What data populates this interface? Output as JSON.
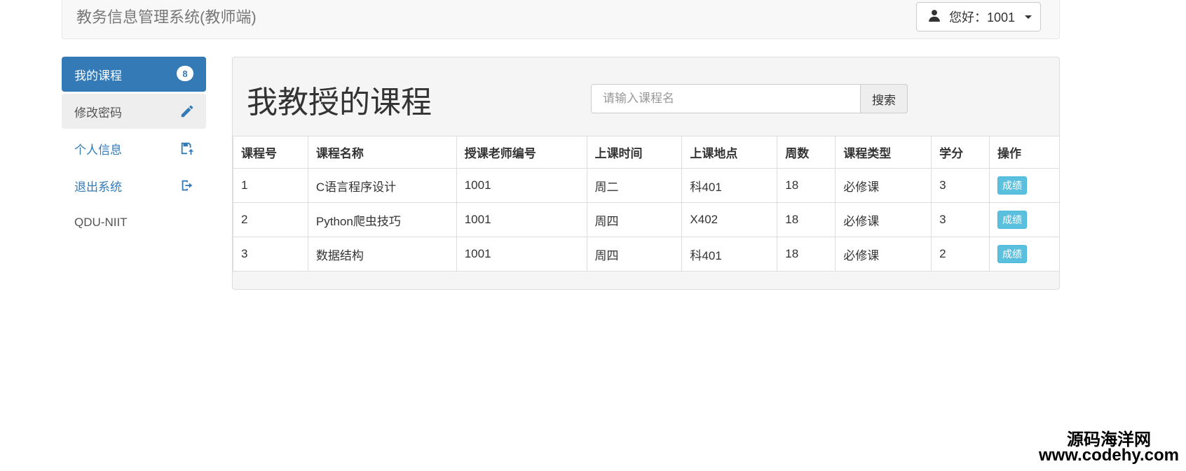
{
  "navbar": {
    "brand": "教务信息管理系统(教师端)",
    "user_label": "您好：1001"
  },
  "sidebar": {
    "items": [
      {
        "label": "我的课程",
        "badge": "8"
      },
      {
        "label": "修改密码",
        "icon": "pencil-icon"
      },
      {
        "label": "个人信息",
        "icon": "save-upload-icon"
      },
      {
        "label": "退出系统",
        "icon": "logout-icon"
      },
      {
        "label": "QDU-NIIT"
      }
    ]
  },
  "main": {
    "title": "我教授的课程",
    "search": {
      "placeholder": "请输入课程名",
      "button_label": "搜索"
    },
    "table": {
      "headers": [
        "课程号",
        "课程名称",
        "授课老师编号",
        "上课时间",
        "上课地点",
        "周数",
        "课程类型",
        "学分",
        "操作"
      ],
      "rows": [
        [
          "1",
          "C语言程序设计",
          "1001",
          "周二",
          "科401",
          "18",
          "必修课",
          "3",
          "成绩"
        ],
        [
          "2",
          "Python爬虫技巧",
          "1001",
          "周四",
          "X402",
          "18",
          "必修课",
          "3",
          "成绩"
        ],
        [
          "3",
          "数据结构",
          "1001",
          "周四",
          "科401",
          "18",
          "必修课",
          "2",
          "成绩"
        ]
      ]
    }
  },
  "watermark": {
    "name": "源码海洋网",
    "url": "www.codehy.com"
  },
  "colors": {
    "primary": "#337ab7",
    "info": "#5bc0de"
  }
}
